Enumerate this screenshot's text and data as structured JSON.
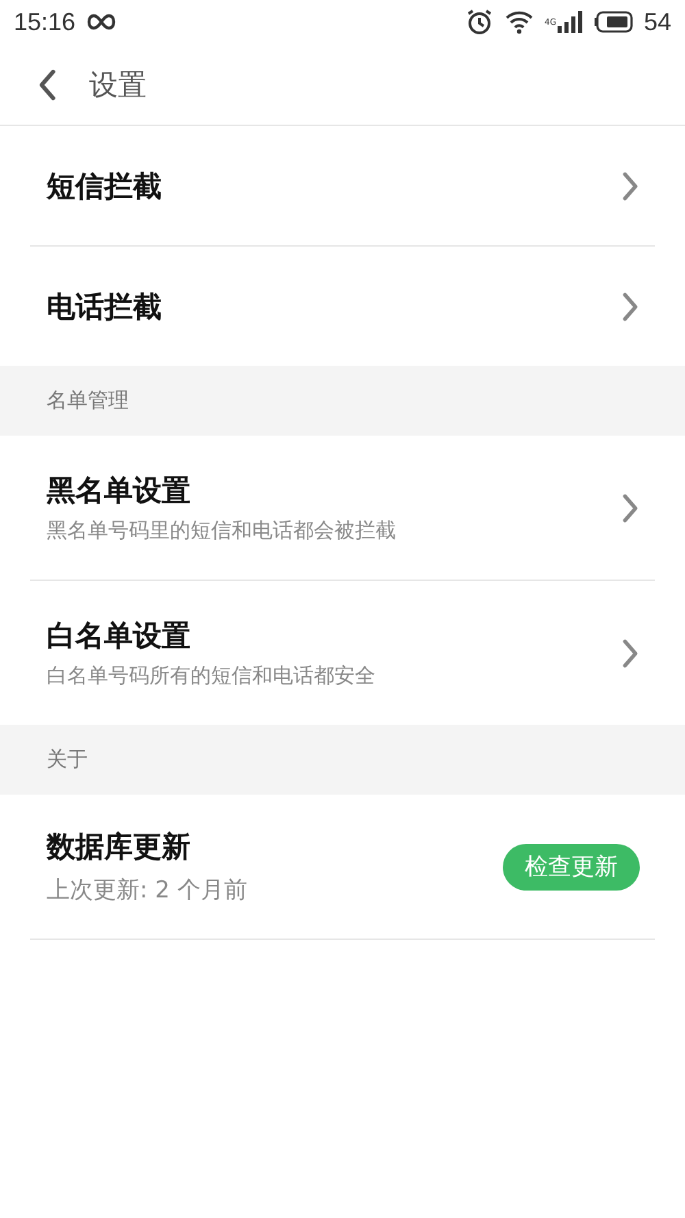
{
  "status_bar": {
    "time": "15:16",
    "network": "4G",
    "battery": "54"
  },
  "header": {
    "title": "设置"
  },
  "sections": [
    {
      "items": [
        {
          "kind": "link",
          "title": "短信拦截"
        },
        {
          "kind": "link",
          "title": "电话拦截"
        }
      ]
    },
    {
      "header": "名单管理",
      "items": [
        {
          "kind": "link",
          "title": "黑名单设置",
          "subtitle": "黑名单号码里的短信和电话都会被拦截"
        },
        {
          "kind": "link",
          "title": "白名单设置",
          "subtitle": "白名单号码所有的短信和电话都安全"
        }
      ]
    },
    {
      "header": "关于",
      "items": [
        {
          "kind": "action",
          "title": "数据库更新",
          "subtitle": "上次更新: 2 个月前",
          "button": "检查更新"
        }
      ]
    }
  ]
}
